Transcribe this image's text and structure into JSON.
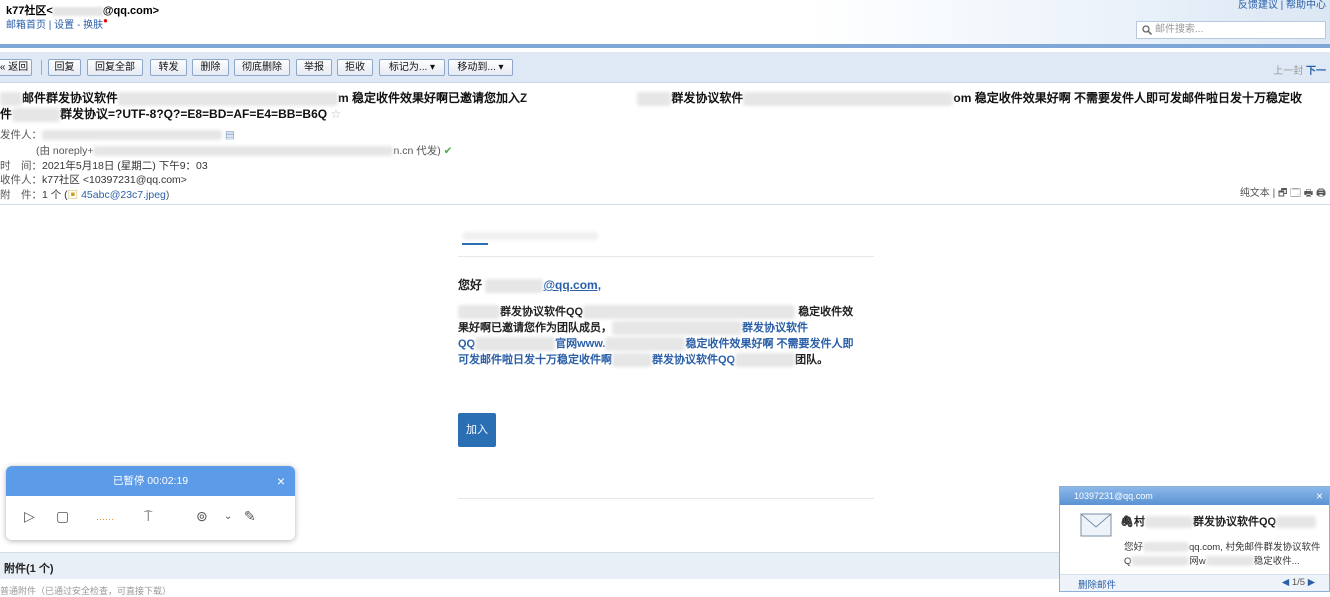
{
  "header": {
    "account_name": "k77社区<",
    "account_email_suffix": "@qq.com>",
    "link_home": "邮箱首页",
    "link_divider": "|",
    "link_settings": "设置",
    "link_skin_sep": "-",
    "link_skin": "换肤",
    "top_links": "反馈建议 | 帮助中心",
    "search_placeholder": "邮件搜索..."
  },
  "toolbar": {
    "back": "« 返回",
    "reply": "回复",
    "reply_all": "回复全部",
    "forward": "转发",
    "delete": "删除",
    "delete_perm": "彻底删除",
    "report": "举报",
    "reject": "拒收",
    "mark_as": "标记为... ▾",
    "move_to": "移动到... ▾",
    "prev": "上一封",
    "next": "下一"
  },
  "mail": {
    "subject_line1_a": "邮件群发协议软件",
    "subject_line1_b": "m 稳定收件效果好啊已邀请您加入Z",
    "subject_line1_c": "群发协议软件",
    "subject_line1_d": "om 稳定收件效果好啊 不需要发件人即可发邮件啦日发十万稳定收",
    "subject_line2_a": "件",
    "subject_line2_b": "群发协议=?UTF-8?Q?=E8=BD=AF=E4=BB=B6Q",
    "star": "☆",
    "sender_label": "发件人：",
    "sender_via": "(由 noreply+",
    "sender_via_end": "n.cn 代发)",
    "time_label": "时　间：",
    "time_value": "2021年5月18日 (星期二) 下午9：03",
    "to_label": "收件人：",
    "to_value": "k77社区 <10397231@qq.com>",
    "att_label": "附　件：",
    "att_value": "1 个 (",
    "att_file": "45abc@23c7.jpeg",
    "att_close": ")",
    "plain_text": "纯文本 |",
    "view_icons": "🗗 🗔 🖶 🖨"
  },
  "content": {
    "greeting_prefix": "您好",
    "greeting_email": "@qq.com,",
    "p1_a": "群发协议软件QQ",
    "p1_b": "稳定收件效",
    "p2_a": "果好啊已邀请您作为团队成员，",
    "p2_b": "群发协议软件",
    "p3_a": "QQ",
    "p3_b": "官网www.",
    "p3_c": "稳定收件效果好啊 不需要发件人即",
    "p4_a": "可发邮件啦日发十万稳定收件啊",
    "p4_b": "群发协议软件QQ",
    "p4_c": "团队。",
    "join_button": "加入"
  },
  "attachments": {
    "title": "附件(1 个)",
    "sub": "普通附件（已通过安全检查，可直接下载）"
  },
  "recorder": {
    "status": "已暂停 00:02:19"
  },
  "notification": {
    "account": "10397231@qq.com",
    "title_prefix": "村",
    "title_mid": "群发协议软件QQ",
    "body_1a": "您好",
    "body_1b": "qq.com, 村免邮件群发协议软件",
    "body_2a": "Q",
    "body_2b": "网w",
    "body_2c": "稳定收件...",
    "delete": "删除邮件",
    "page": "1/5"
  },
  "colors": {
    "accent": "#2a5fa8",
    "toolbar_bg": "#dfe9f5",
    "recorder_head": "#5b9be7",
    "join_button": "#2a6fb3"
  }
}
